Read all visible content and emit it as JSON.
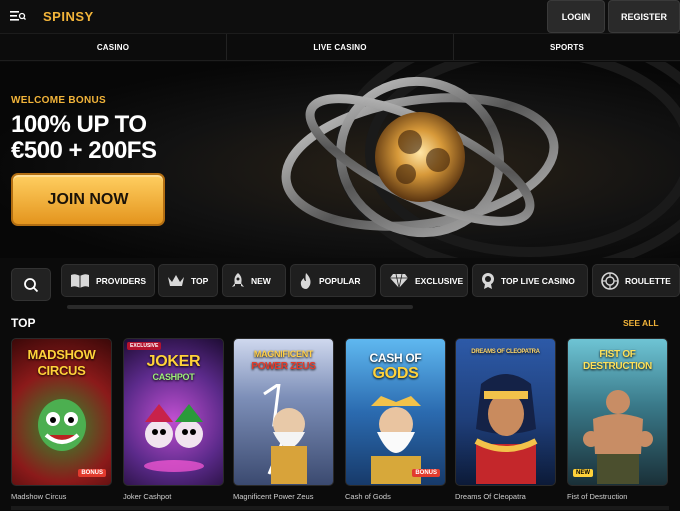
{
  "header": {
    "logo": "SPINSY",
    "login_label": "LOGIN",
    "register_label": "REGISTER"
  },
  "topnav": [
    "CASINO",
    "LIVE CASINO",
    "SPORTS"
  ],
  "hero": {
    "bonus_label": "WELCOME BONUS",
    "title_line1": "100% UP TO",
    "title_line2": "€500 + 200FS",
    "cta": "JOIN NOW"
  },
  "categories": [
    {
      "label": "PROVIDERS",
      "icon": "book-icon"
    },
    {
      "label": "TOP",
      "icon": "crown-icon"
    },
    {
      "label": "NEW",
      "icon": "rocket-icon"
    },
    {
      "label": "POPULAR",
      "icon": "flame-icon"
    },
    {
      "label": "EXCLUSIVE",
      "icon": "diamond-icon"
    },
    {
      "label": "TOP LIVE CASINO",
      "icon": "medal-icon"
    },
    {
      "label": "ROULETTE",
      "icon": "roulette-icon"
    }
  ],
  "section": {
    "title": "TOP",
    "see_all": "SEE ALL"
  },
  "games": [
    {
      "name": "Madshow Circus",
      "art_line1": "MADSHOW",
      "art_line2": "CIRCUS",
      "badge": "BONUS",
      "color": "#8b1a1a"
    },
    {
      "name": "Joker Cashpot",
      "art_line1": "JOKER",
      "art_line2": "CASHPOT",
      "badge": "EXCLUSIVE",
      "color": "#5b2a8a"
    },
    {
      "name": "Magnificent Power Zeus",
      "art_line1": "MAGNIFICENT",
      "art_line2": "POWER ZEUS",
      "badge": "",
      "color": "#6a7fb0"
    },
    {
      "name": "Cash of Gods",
      "art_line1": "CASH OF",
      "art_line2": "GODS",
      "badge": "BONUS",
      "color": "#2b6bb0"
    },
    {
      "name": "Dreams Of Cleopatra",
      "art_line1": "DREAMS OF CLEOPATRA",
      "art_line2": "",
      "badge": "",
      "color": "#1f3f7a"
    },
    {
      "name": "Fist of Destruction",
      "art_line1": "FIST OF",
      "art_line2": "DESTRUCTION",
      "badge": "NEW",
      "color": "#3a7a8a"
    }
  ],
  "colors": {
    "accent": "#f2b43a",
    "background": "#0b0b0b"
  }
}
